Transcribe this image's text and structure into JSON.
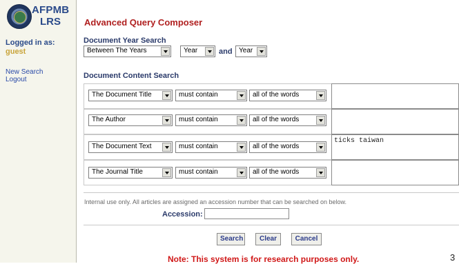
{
  "logo": {
    "line1": "AFPMB",
    "line2": "LRS"
  },
  "sidebar": {
    "logged_in_label": "Logged in as:",
    "username": "guest",
    "links": [
      "New Search",
      "Logout"
    ]
  },
  "page_title": "Advanced Query Composer",
  "year_search": {
    "label": "Document Year Search",
    "mode": "Between The Years",
    "from": "Year",
    "and_label": "and",
    "to": "Year"
  },
  "content_search": {
    "label": "Document Content Search",
    "rows": [
      {
        "field": "The Document Title",
        "condition": "must contain",
        "match": "all of the words",
        "value": ""
      },
      {
        "field": "The Author",
        "condition": "must contain",
        "match": "all of the words",
        "value": ""
      },
      {
        "field": "The Document Text",
        "condition": "must contain",
        "match": "all of the words",
        "value": "ticks taiwan"
      },
      {
        "field": "The Journal Title",
        "condition": "must contain",
        "match": "all of the words",
        "value": ""
      }
    ]
  },
  "internal_note": "Internal use only. All articles are assigned an accession number that can be searched on below.",
  "accession": {
    "label": "Accession:",
    "value": ""
  },
  "buttons": {
    "search": "Search",
    "clear": "Clear",
    "cancel": "Cancel"
  },
  "footer_note": "Note: This system is for research purposes only.",
  "page_number": "3"
}
